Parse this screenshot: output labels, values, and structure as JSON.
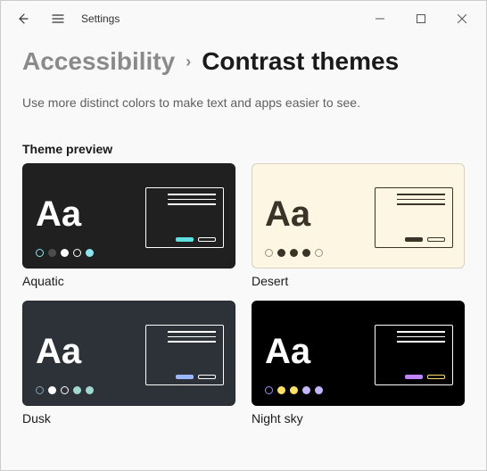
{
  "titlebar": {
    "app_name": "Settings"
  },
  "breadcrumb": {
    "prev": "Accessibility",
    "current": "Contrast themes"
  },
  "description": "Use more distinct colors to make text and apps easier to see.",
  "section_label": "Theme preview",
  "themes": {
    "aquatic": {
      "name": "Aquatic",
      "bg": "#202020",
      "fg": "#ffffff",
      "dots": [
        "#8ee3ef",
        "#4d4d4d",
        "#ffffff",
        "#202020",
        "#8ee3ef"
      ],
      "panel_border": "#ffffff",
      "line": "#ffffff",
      "btn1": "#5ee0e0",
      "btn2_border": "#ffffff",
      "aa": "Aa"
    },
    "desert": {
      "name": "Desert",
      "bg": "#fdf6e3",
      "fg": "#3b3228",
      "dots": [
        "#a09080",
        "#3b3228",
        "#3b3228",
        "#3b3228",
        "#a09080"
      ],
      "panel_border": "#3b3228",
      "line": "#3b3228",
      "btn1": "#3b3228",
      "btn2_border": "#3b3228",
      "aa": "Aa"
    },
    "dusk": {
      "name": "Dusk",
      "bg": "#2d3138",
      "fg": "#ffffff",
      "dots": [
        "#8ca0b3",
        "#ffffff",
        "#2d3138",
        "#a0d8cf",
        "#a0d8cf"
      ],
      "panel_border": "#ffffff",
      "line": "#ffffff",
      "btn1": "#9bb8ff",
      "btn2_border": "#ffffff",
      "aa": "Aa"
    },
    "nightsky": {
      "name": "Night sky",
      "bg": "#000000",
      "fg": "#ffffff",
      "dots": [
        "#9a8cff",
        "#ffe066",
        "#ffe066",
        "#c4b5fd",
        "#c4b5fd"
      ],
      "panel_border": "#ffffff",
      "line": "#ffffff",
      "btn1": "#c084fc",
      "btn2_border": "#ffe066",
      "aa": "Aa"
    }
  }
}
